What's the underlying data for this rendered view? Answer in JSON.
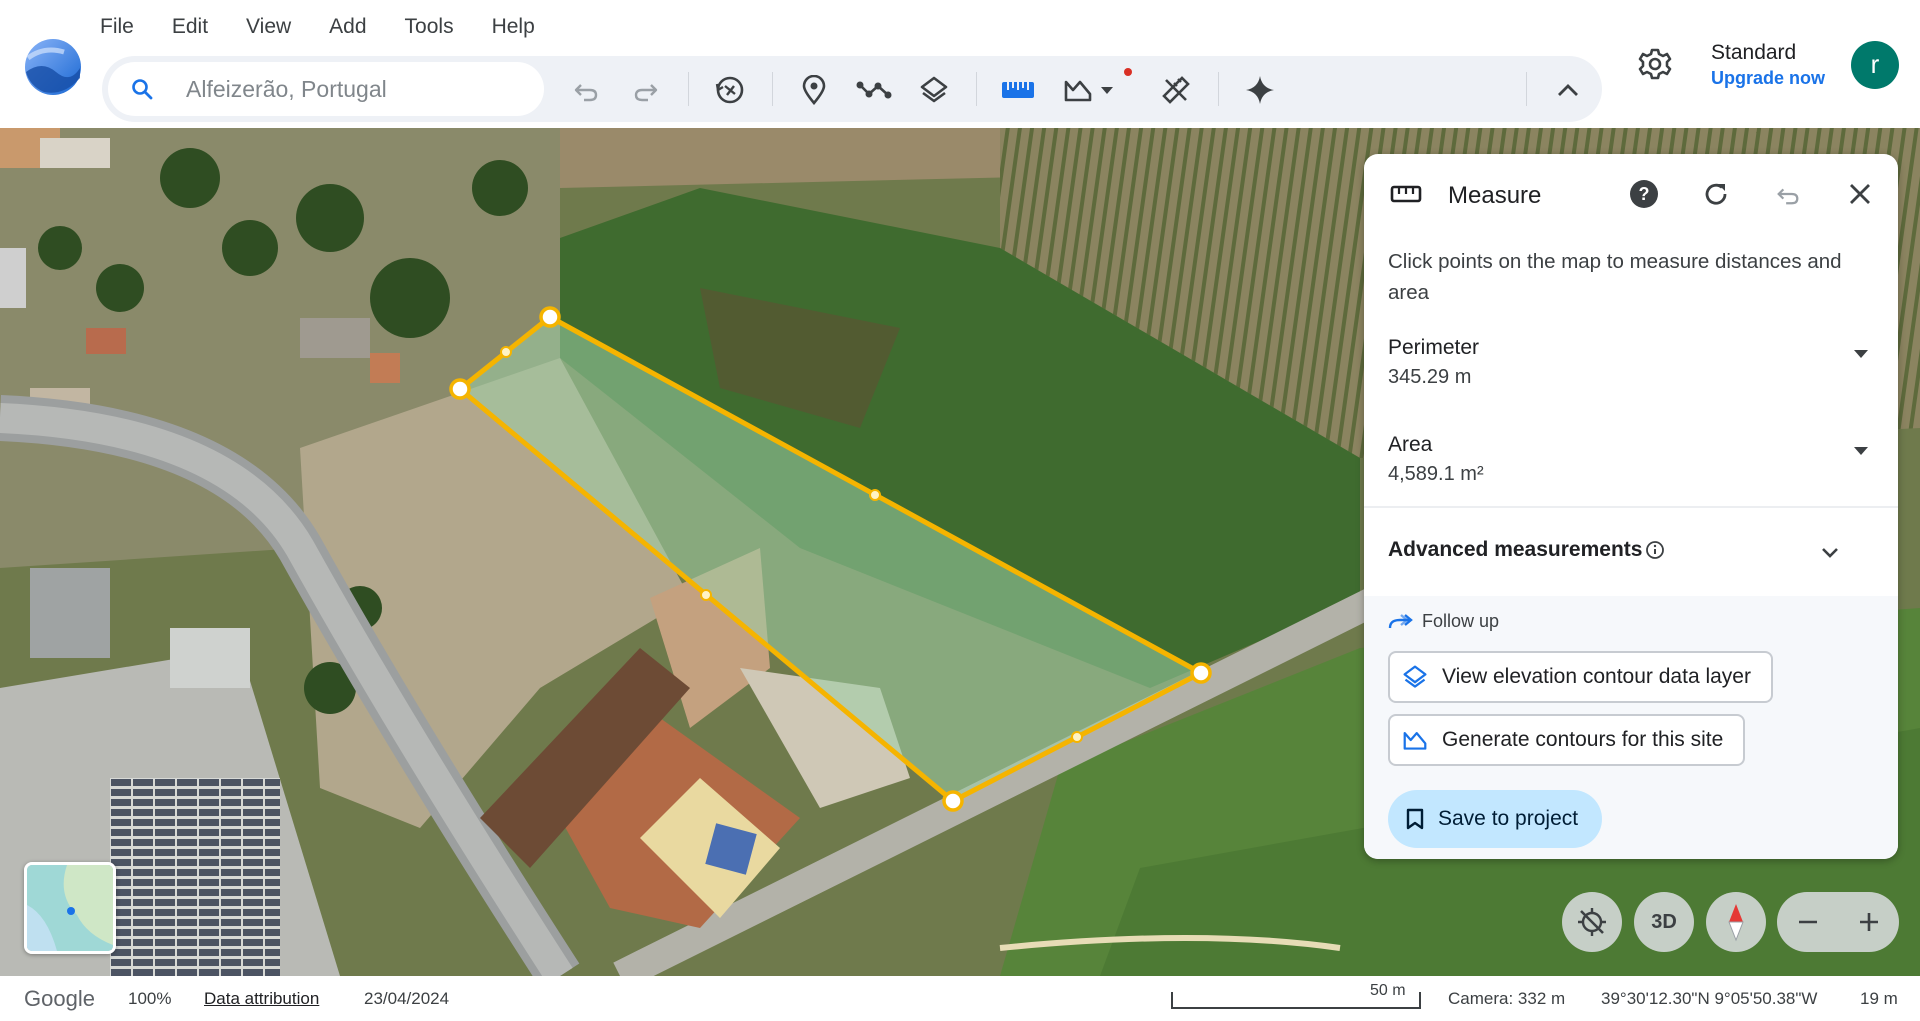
{
  "menu": [
    "File",
    "Edit",
    "View",
    "Add",
    "Tools",
    "Help"
  ],
  "search": {
    "placeholder": "Alfeizerão, Portugal"
  },
  "toolbar": {
    "icons": [
      "undo-icon",
      "redo-icon",
      "historical-imagery-icon",
      "placemark-icon",
      "path-icon",
      "layers-icon",
      "ruler-icon",
      "elevation-icon",
      "measure-tools-icon",
      "sparkle-icon",
      "chevron-up-icon"
    ]
  },
  "account": {
    "plan": "Standard",
    "upgrade": "Upgrade now",
    "avatar_letter": "r",
    "avatar_color": "#00796b"
  },
  "measure": {
    "title": "Measure",
    "description": "Click points on the map to measure distances and area",
    "perimeter_label": "Perimeter",
    "perimeter_value": "345.29 m",
    "area_label": "Area",
    "area_value": "4,589.1 m²",
    "advanced_label": "Advanced measurements",
    "follow_up": "Follow up",
    "actions": [
      "View elevation contour data layer",
      "Generate contours for this site"
    ],
    "save": "Save to project"
  },
  "map_controls": {
    "mode": "3D"
  },
  "footer": {
    "brand": "Google",
    "zoom": "100%",
    "attribution": "Data attribution",
    "date": "23/04/2024",
    "scale": "50 m",
    "camera": "Camera: 332 m",
    "coords": "39°30'12.30\"N 9°05'50.38\"W",
    "elevation": "19 m"
  },
  "colors": {
    "accent": "#1a73e8",
    "polygon_stroke": "#f5b400",
    "save_bg": "#c2e7ff"
  }
}
